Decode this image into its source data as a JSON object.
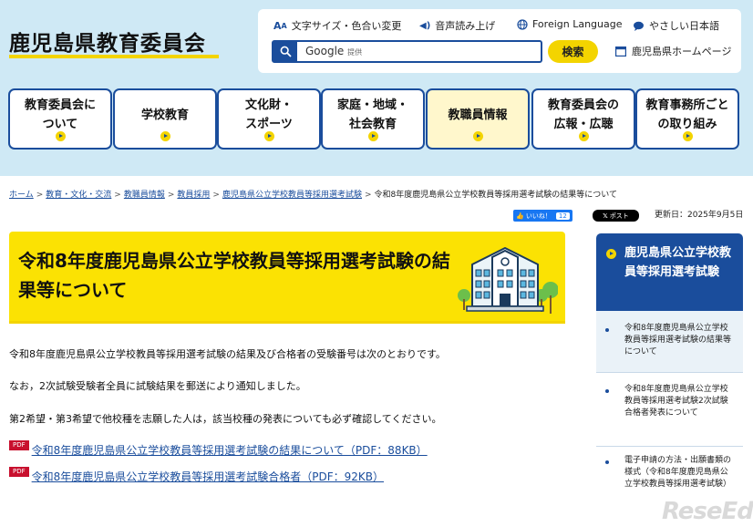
{
  "site": {
    "title": "鹿児島県教育委員会"
  },
  "utility": {
    "text_size": "文字サイズ・色合い変更",
    "read_aloud": "音声読み上げ",
    "foreign": "Foreign Language",
    "easy_japanese": "やさしい日本語",
    "search_brand": "Google",
    "search_brand_sub": "提供",
    "search_button": "検索",
    "pref_link": "鹿児島県ホームページ"
  },
  "nav": {
    "items": [
      {
        "l1": "教育委員会に",
        "l2": "ついて"
      },
      {
        "l1": "学校教育",
        "l2": ""
      },
      {
        "l1": "文化財・",
        "l2": "スポーツ"
      },
      {
        "l1": "家庭・地域・",
        "l2": "社会教育"
      },
      {
        "l1": "教職員情報",
        "l2": ""
      },
      {
        "l1": "教育委員会の",
        "l2": "広報・広聴"
      },
      {
        "l1": "教育事務所ごと",
        "l2": "の取り組み"
      }
    ]
  },
  "breadcrumb": {
    "items": [
      "ホーム",
      "教育・文化・交流",
      "教職員情報",
      "教員採用",
      "鹿児島県公立学校教員等採用選考試験"
    ],
    "separator": ">",
    "current": "令和8年度鹿児島県公立学校教員等採用選考試験の結果等について"
  },
  "social": {
    "like_label": "いいね！",
    "like_count": "12",
    "post_label": "ポスト"
  },
  "updated": "更新日：2025年9月5日",
  "page": {
    "title": "令和8年度鹿児島県公立学校教員等採用選考試験の結果等について",
    "paragraphs": [
      "令和8年度鹿児島県公立学校教員等採用選考試験の結果及び合格者の受験番号は次のとおりです。",
      "なお，2次試験受験者全員に試験結果を郵送により通知しました。",
      "第2希望・第3希望で他校種を志願した人は，該当校種の発表についても必ず確認してください。"
    ],
    "pdf_badge": "PDF",
    "links": [
      "令和8年度鹿児島県公立学校教員等採用選考試験の結果について（PDF：88KB）",
      "令和8年度鹿児島県公立学校教員等採用選考試験合格者（PDF：92KB）"
    ]
  },
  "sidebar": {
    "heading": "鹿児島県公立学校教員等採用選考試験",
    "items": [
      "令和8年度鹿児島県公立学校教員等採用選考試験の結果等について",
      "令和8年度鹿児島県公立学校教員等採用選考試験2次試験合格者発表について",
      "電子申請の方法・出願書類の様式（令和8年度鹿児島県公立学校教員等採用選考試験）"
    ]
  },
  "watermark": "ReseEd",
  "colors": {
    "brand_blue": "#1a4d9c",
    "accent_yellow": "#f3d400",
    "header_bg": "#cfe9f5"
  }
}
